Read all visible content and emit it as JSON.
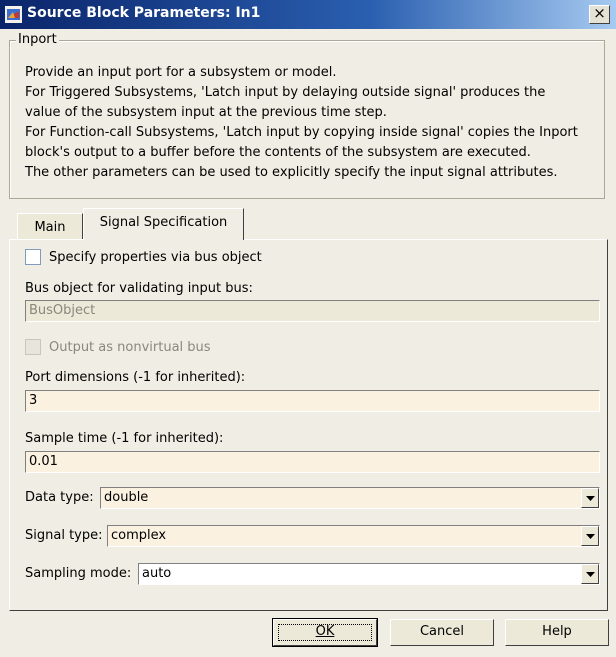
{
  "window": {
    "title": "Source Block Parameters: In1",
    "close_label": "×"
  },
  "group": {
    "title": "Inport",
    "description": "Provide an input port for a subsystem or model.\nFor Triggered Subsystems, 'Latch input by delaying outside signal' produces the\nvalue of the subsystem input at the previous time step.\nFor Function-call Subsystems, 'Latch input by copying inside signal' copies the Inport\nblock's output to a buffer before the contents of the subsystem are executed.\nThe other parameters can be used to explicitly specify the input signal attributes."
  },
  "tabs": [
    {
      "label": "Main",
      "active": false
    },
    {
      "label": "Signal Specification",
      "active": true
    }
  ],
  "panel": {
    "bus_object_checkbox": {
      "label": "Specify properties via bus object",
      "checked": false
    },
    "bus_object_label": "Bus object for validating input bus:",
    "bus_object_value": "BusObject",
    "nonvirtual_checkbox": {
      "label": "Output as nonvirtual bus",
      "checked": false
    },
    "port_dims_label": "Port dimensions (-1 for inherited):",
    "port_dims_value": "3",
    "sample_time_label": "Sample time (-1 for inherited):",
    "sample_time_value": "0.01",
    "data_type_label": "Data type:",
    "data_type_value": "double",
    "signal_type_label": "Signal type:",
    "signal_type_value": "complex",
    "sampling_mode_label": "Sampling mode:",
    "sampling_mode_value": "auto"
  },
  "buttons": {
    "ok": "OK",
    "cancel": "Cancel",
    "help": "Help"
  }
}
